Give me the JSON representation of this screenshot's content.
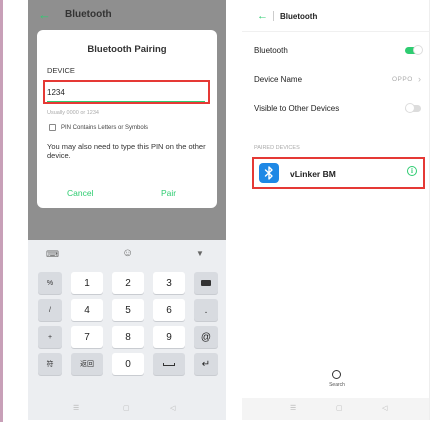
{
  "left": {
    "header_title": "Bluetooth",
    "dialog": {
      "title": "Bluetooth Pairing",
      "device_label": "DEVICE",
      "pin_value": "1234",
      "hint": "Usually 0000 or 1234",
      "checkbox_label": "PIN Contains Letters or Symbols",
      "note": "You may also need to type this PIN on the other device.",
      "cancel_label": "Cancel",
      "pair_label": "Pair"
    },
    "keyboard": {
      "rows": [
        [
          "%",
          "1",
          "2",
          "3",
          "del"
        ],
        [
          "/",
          "4",
          "5",
          "6",
          "."
        ],
        [
          "+",
          "7",
          "8",
          "9",
          "@"
        ],
        [
          "符",
          "返回",
          "0",
          "space",
          "enter"
        ]
      ]
    }
  },
  "right": {
    "header_title": "Bluetooth",
    "bluetooth_label": "Bluetooth",
    "bluetooth_on": true,
    "device_name_label": "Device Name",
    "device_name_value": "OPPO",
    "visible_label": "Visible to Other Devices",
    "visible_on": false,
    "paired_header": "PAIRED DEVICES",
    "paired_device": "vLinker BM",
    "search_label": "Search"
  },
  "colors": {
    "accent": "#2ecc71",
    "highlight": "#e53935",
    "bt_icon": "#1e88e5"
  }
}
